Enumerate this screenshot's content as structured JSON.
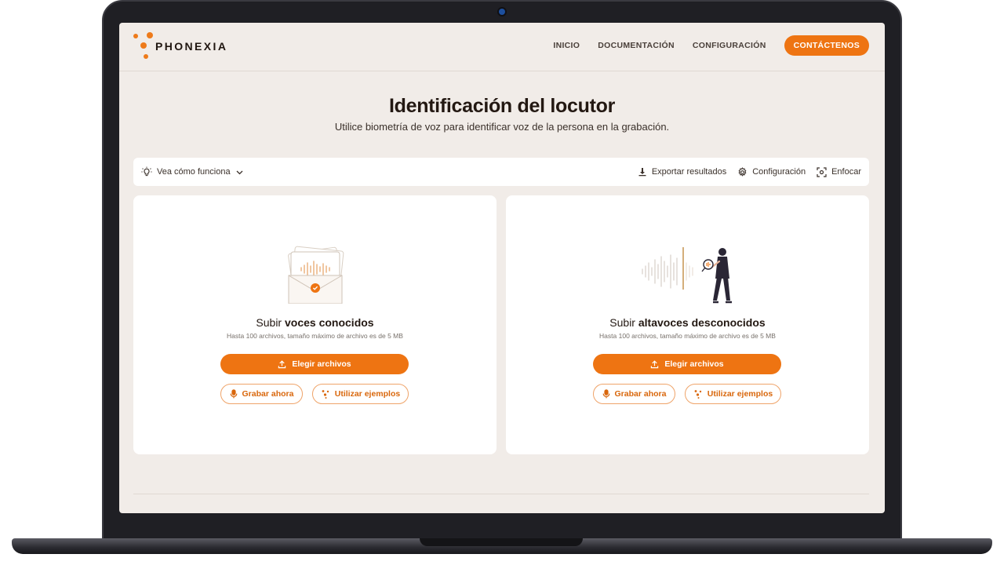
{
  "brand": {
    "name": "PHONEXIA",
    "accent": "#ee7412"
  },
  "nav": {
    "items": [
      "INICIO",
      "DOCUMENTACIÓN",
      "CONFIGURACIÓN"
    ],
    "cta": "CONTÁCTENOS"
  },
  "page": {
    "title": "Identificación del locutor",
    "subtitle": "Utilice biometría de voz para identificar voz de la persona en la grabación."
  },
  "toolbar": {
    "how_it_works": "Vea cómo funciona",
    "export": "Exportar resultados",
    "settings": "Configuración",
    "focus": "Enfocar"
  },
  "cards": [
    {
      "title_prefix": "Subir",
      "title_bold": "voces conocidos",
      "hint": "Hasta 100 archivos, tamaño máximo de archivo es de 5 MB",
      "choose": "Elegir archivos",
      "record": "Grabar ahora",
      "examples": "Utilizar ejemplos"
    },
    {
      "title_prefix": "Subir",
      "title_bold": "altavoces desconocidos",
      "hint": "Hasta 100 archivos, tamaño máximo de archivo es de 5 MB",
      "choose": "Elegir archivos",
      "record": "Grabar ahora",
      "examples": "Utilizar ejemplos"
    }
  ]
}
